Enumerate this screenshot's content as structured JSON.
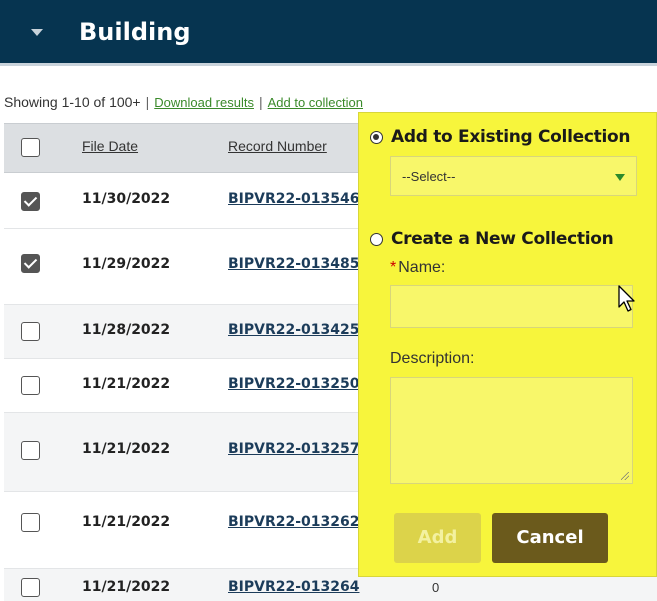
{
  "header": {
    "title": "Building"
  },
  "status": {
    "showing": "Showing 1-10 of 100+",
    "separator": "|",
    "download_link": "Download results",
    "collection_link": "Add to collection"
  },
  "table": {
    "columns": [
      "File Date",
      "Record Number"
    ],
    "rows": [
      {
        "date": "11/30/2022",
        "record": "BIPVR22-013546",
        "checked": true
      },
      {
        "date": "11/29/2022",
        "record": "BIPVR22-013485",
        "checked": true
      },
      {
        "date": "11/28/2022",
        "record": "BIPVR22-013425",
        "checked": false
      },
      {
        "date": "11/21/2022",
        "record": "BIPVR22-013250",
        "checked": false
      },
      {
        "date": "11/21/2022",
        "record": "BIPVR22-013257",
        "checked": false
      },
      {
        "date": "11/21/2022",
        "record": "BIPVR22-013262",
        "checked": false
      },
      {
        "date": "11/21/2022",
        "record": "BIPVR22-013264",
        "checked": false,
        "extra": "0"
      }
    ]
  },
  "popup": {
    "existing_label": "Add to Existing Collection",
    "select_value": "--Select--",
    "new_label": "Create a New Collection",
    "required_mark": "*",
    "name_label": "Name:",
    "description_label": "Description:",
    "add_button": "Add",
    "cancel_button": "Cancel"
  },
  "colors": {
    "header_bg": "#063450",
    "popup_bg": "#f7f53c",
    "link_green": "#3a8a2a",
    "cancel_bg": "#6b5a1c"
  },
  "icons": [
    "chevron-down-icon",
    "checkbox-icon",
    "radio-icon",
    "dropdown-arrow-icon",
    "mouse-cursor-icon"
  ]
}
